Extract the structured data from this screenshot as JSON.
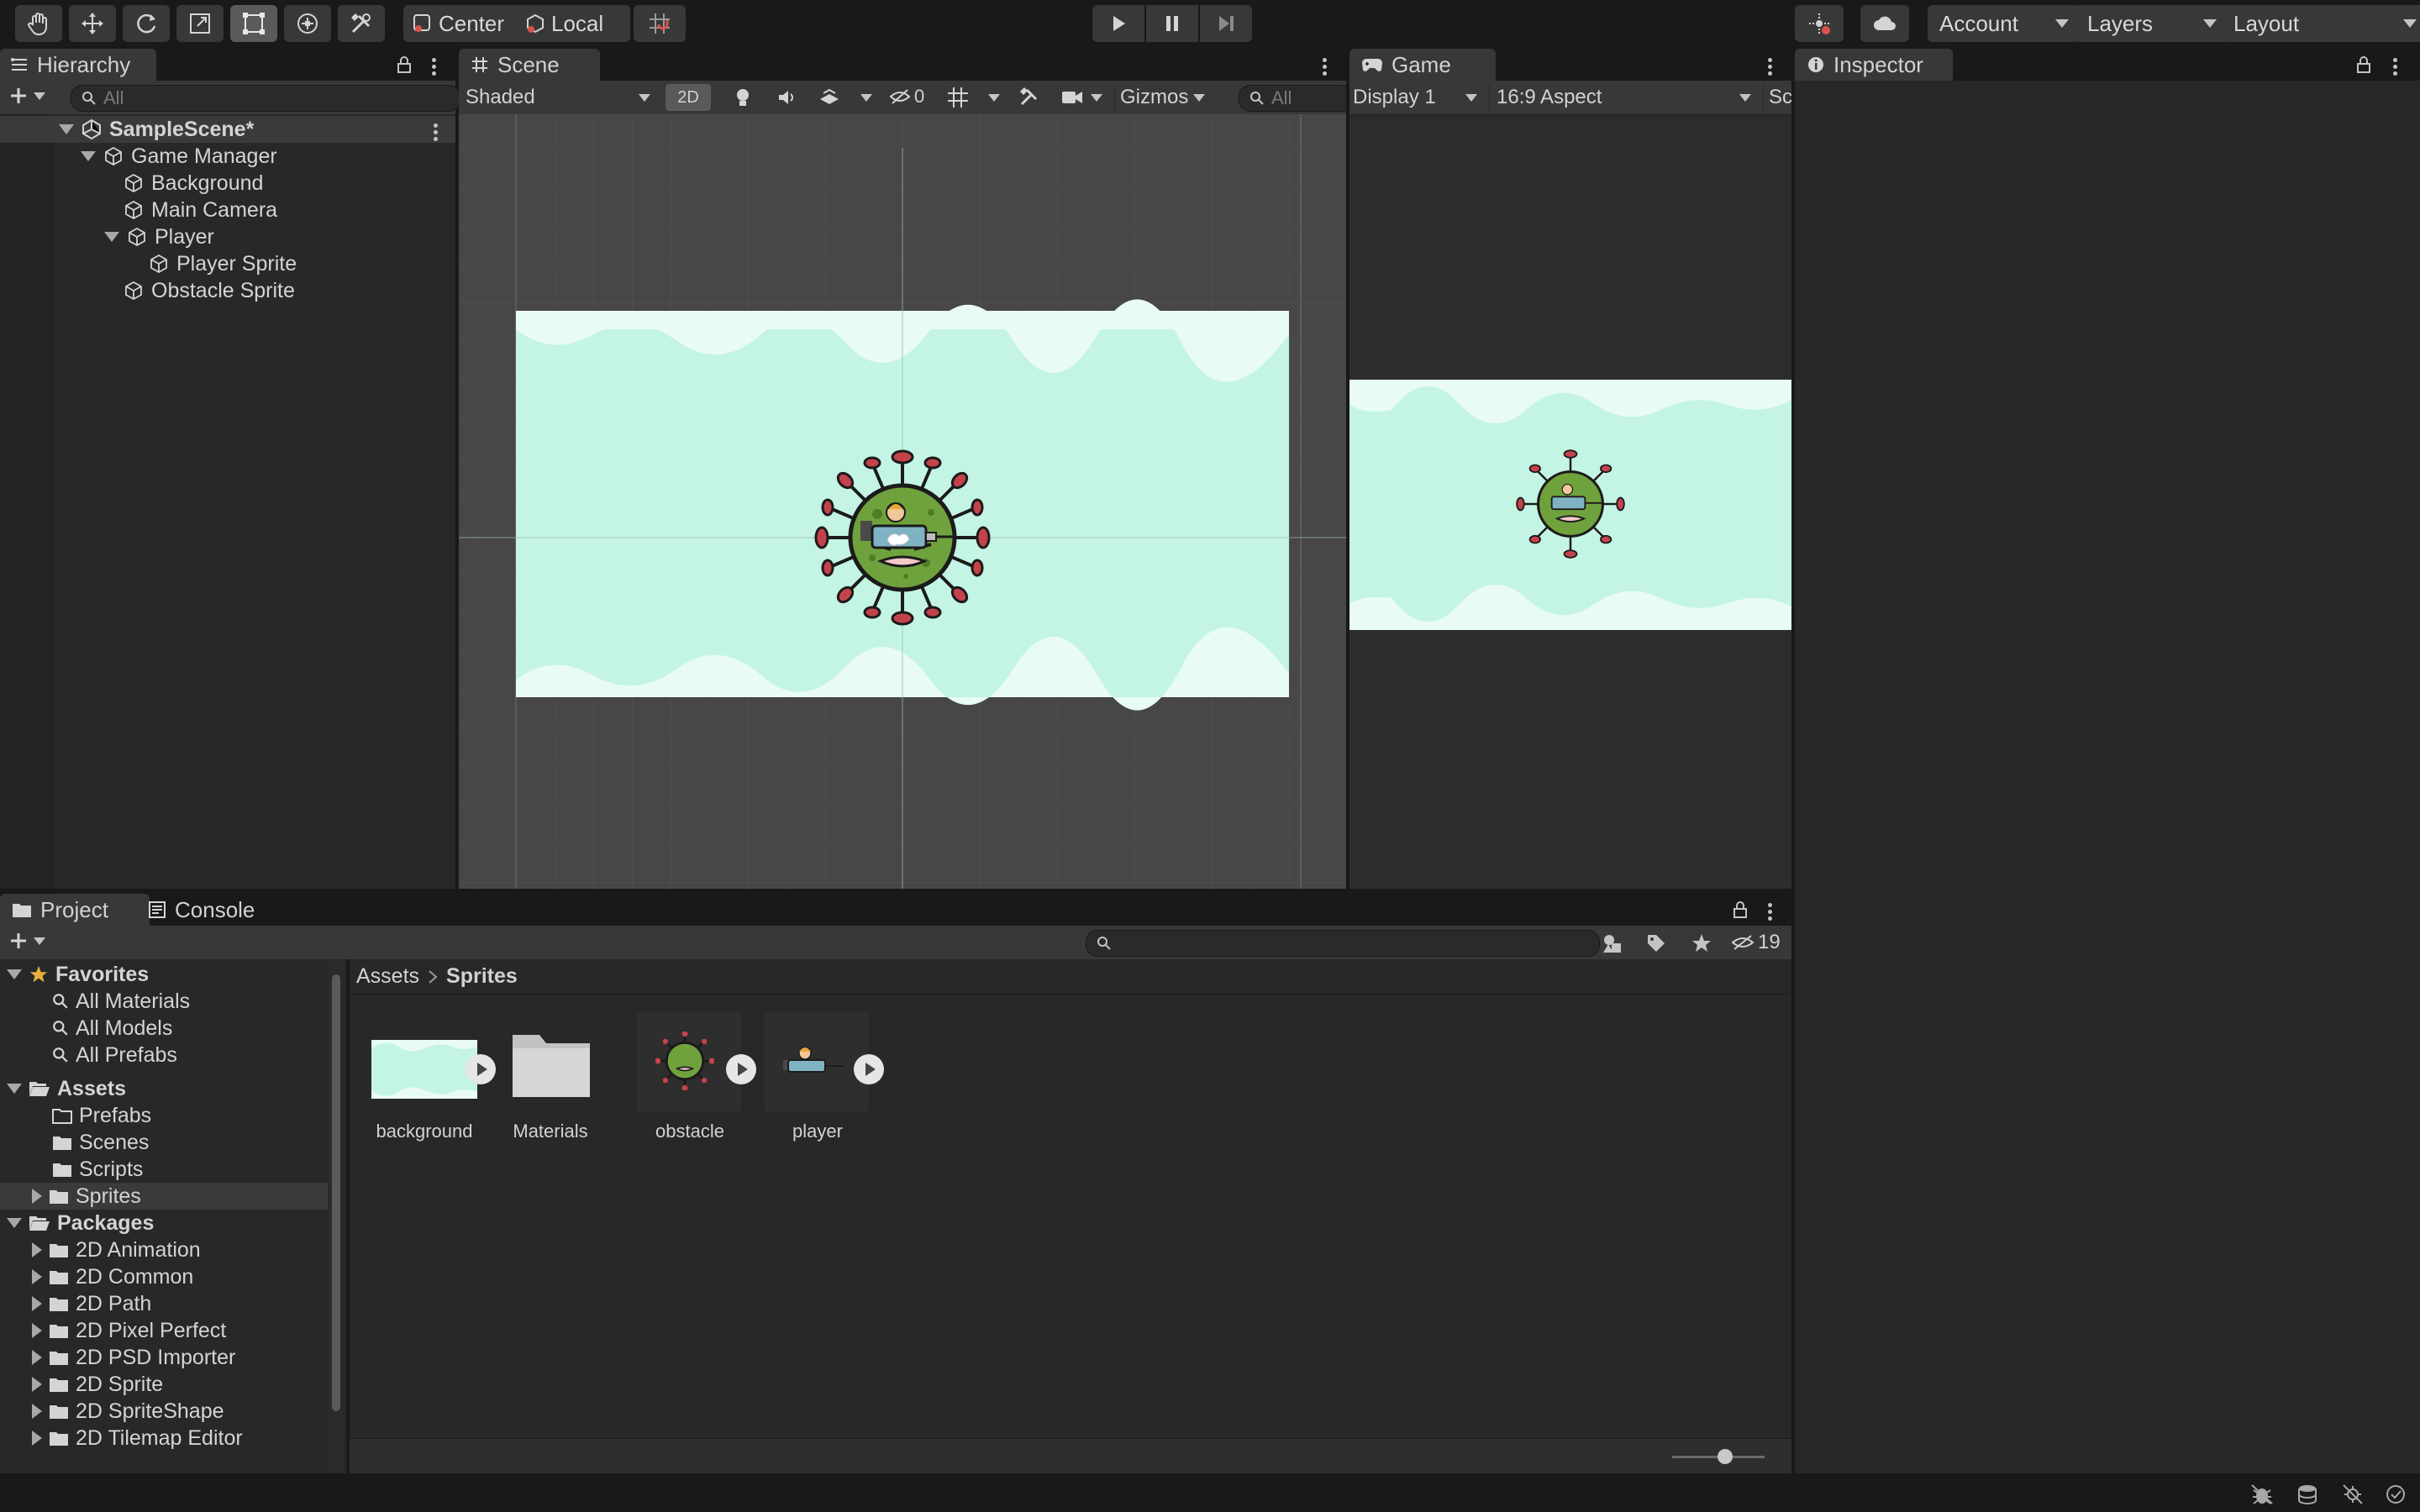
{
  "toolbar": {
    "pivot_label": "Center",
    "space_label": "Local",
    "account_label": "Account",
    "layers_label": "Layers",
    "layout_label": "Layout"
  },
  "hierarchy": {
    "tab_label": "Hierarchy",
    "search_placeholder": "All",
    "scene_name": "SampleScene*",
    "items": [
      {
        "label": "Game Manager"
      },
      {
        "label": "Background"
      },
      {
        "label": "Main Camera"
      },
      {
        "label": "Player"
      },
      {
        "label": "Player Sprite"
      },
      {
        "label": "Obstacle Sprite"
      }
    ]
  },
  "scene": {
    "tab_label": "Scene",
    "shading_mode": "Shaded",
    "mode_2d": "2D",
    "hidden_count": "0",
    "gizmos_label": "Gizmos",
    "search_placeholder": "All"
  },
  "game": {
    "tab_label": "Game",
    "display": "Display 1",
    "aspect": "16:9 Aspect",
    "scale_truncated": "Sc"
  },
  "inspector": {
    "tab_label": "Inspector"
  },
  "project": {
    "tab_label": "Project",
    "console_tab_label": "Console",
    "hidden_packages_count": "19",
    "breadcrumb": [
      "Assets",
      "Sprites"
    ],
    "favorites": {
      "label": "Favorites",
      "items": [
        "All Materials",
        "All Models",
        "All Prefabs"
      ]
    },
    "assets": {
      "label": "Assets",
      "items": [
        "Prefabs",
        "Scenes",
        "Scripts",
        "Sprites"
      ]
    },
    "packages": {
      "label": "Packages",
      "items": [
        "2D Animation",
        "2D Common",
        "2D Path",
        "2D Pixel Perfect",
        "2D PSD Importer",
        "2D Sprite",
        "2D SpriteShape",
        "2D Tilemap Editor"
      ]
    },
    "grid_items": [
      {
        "label": "background",
        "icon": "sprite-thumb"
      },
      {
        "label": "Materials",
        "icon": "folder-icon"
      },
      {
        "label": "obstacle",
        "icon": "virus-sprite-thumb"
      },
      {
        "label": "player",
        "icon": "syringe-sprite-thumb"
      }
    ]
  },
  "colors": {
    "sky": "#c4f4e4",
    "wave": "#e8fbf4",
    "virus_green": "#6fa23c",
    "virus_spike": "#c4434a"
  }
}
